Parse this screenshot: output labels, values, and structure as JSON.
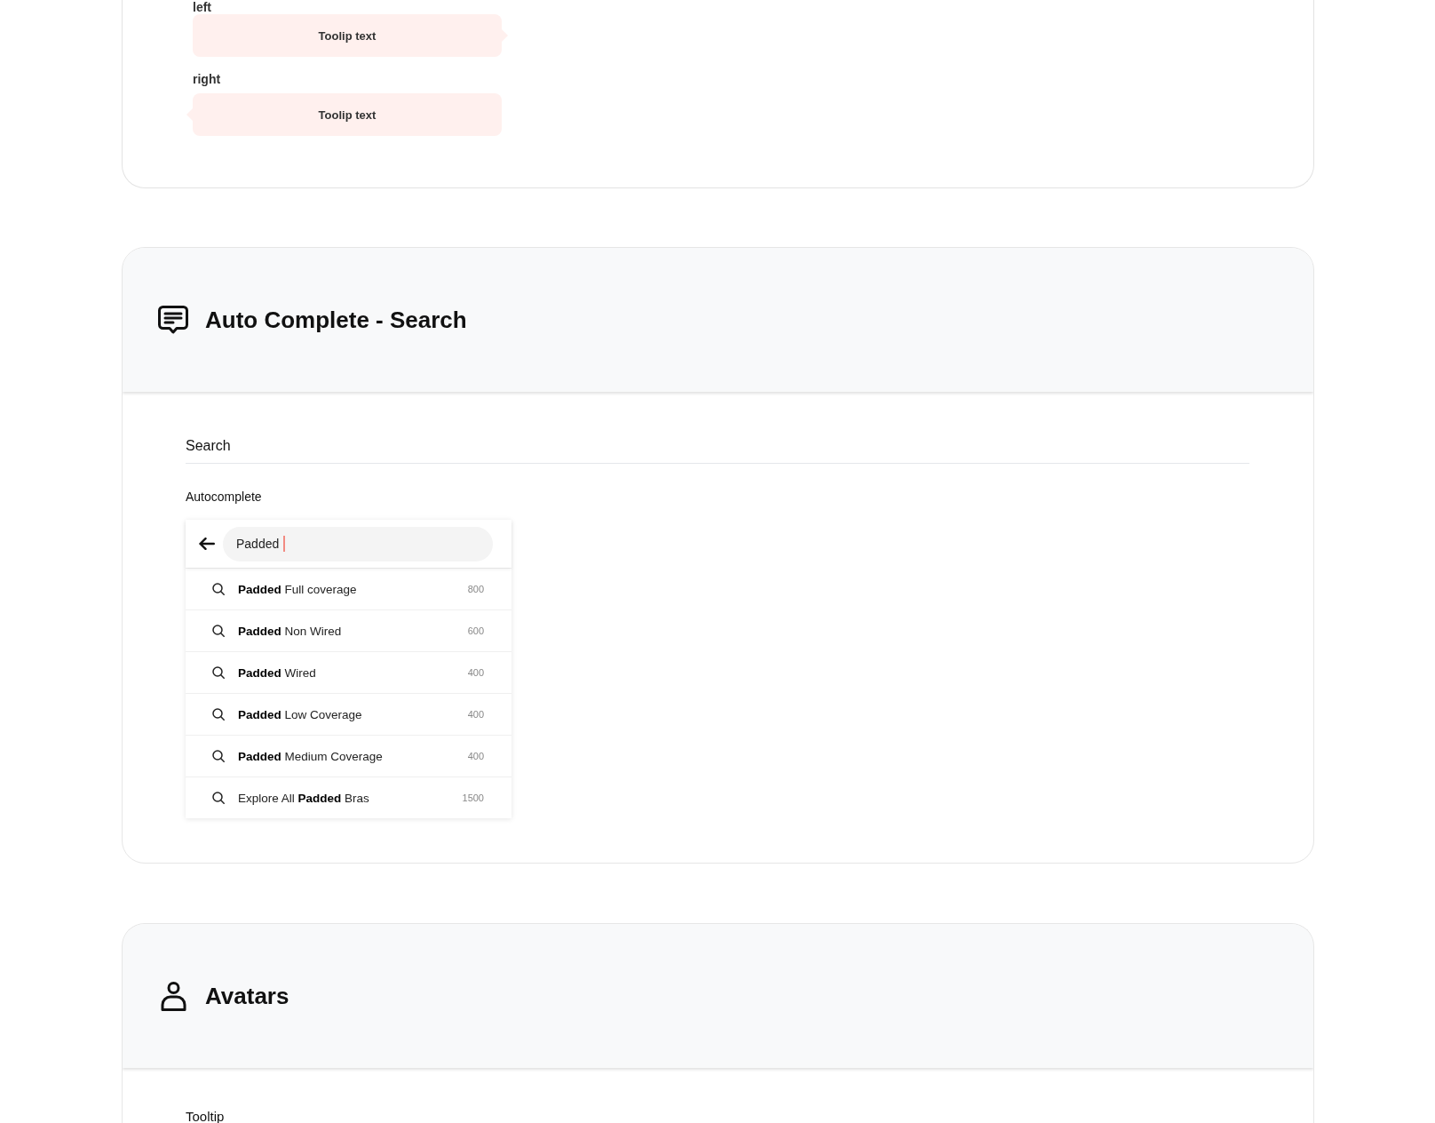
{
  "tooltip_examples": [
    {
      "label": "left",
      "kind": "left",
      "text": "Toolip text"
    },
    {
      "label": "right",
      "kind": "right",
      "text": "Toolip text"
    }
  ],
  "autocomplete_section": {
    "title": "Auto Complete - Search",
    "heading": "Search",
    "demo_label": "Autocomplete",
    "search": {
      "value": "Padded",
      "focused": true
    },
    "suggestions": [
      {
        "text": "**Padded** Full coverage",
        "count": "800"
      },
      {
        "text": "**Padded** Non Wired",
        "count": "600"
      },
      {
        "text": "**Padded** Wired",
        "count": "400"
      },
      {
        "text": "**Padded** Low Coverage",
        "count": "400"
      },
      {
        "text": "**Padded** Medium Coverage",
        "count": "400"
      },
      {
        "text": "Explore All **Padded** Bras",
        "count": "1500"
      }
    ]
  },
  "avatars_section": {
    "title": "Avatars",
    "subheading": "Tooltip"
  }
}
